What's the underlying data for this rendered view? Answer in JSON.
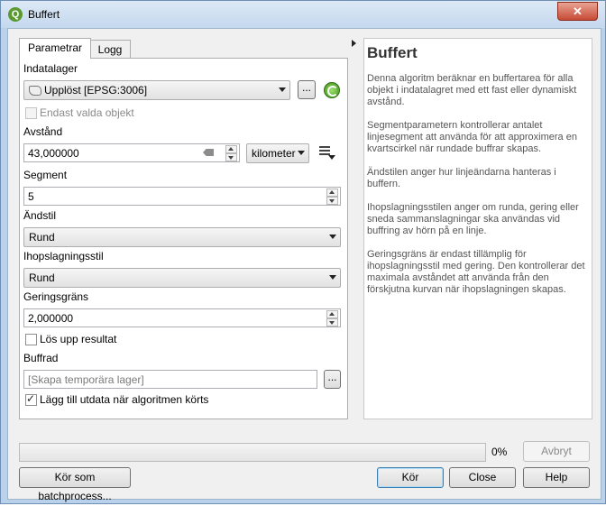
{
  "window": {
    "title": "Buffert",
    "app_icon": "qgis-icon",
    "close_glyph": "✕"
  },
  "tabs": [
    {
      "label": "Parametrar"
    },
    {
      "label": "Logg"
    }
  ],
  "params": {
    "input_label": "Indatalager",
    "input_value": "Upplöst [EPSG:3006]",
    "browse_label": "...",
    "selected_only_label": "Endast valda objekt",
    "distance_label": "Avstånd",
    "distance_value": "43,000000",
    "distance_unit": "kilometer",
    "segments_label": "Segment",
    "segments_value": "5",
    "endcap_label": "Ändstil",
    "endcap_value": "Rund",
    "join_label": "Ihopslagningsstil",
    "join_value": "Rund",
    "miter_label": "Geringsgräns",
    "miter_value": "2,000000",
    "dissolve_label": "Lös upp resultat",
    "output_label": "Buffrad",
    "output_placeholder": "[Skapa temporära lager]",
    "output_browse_label": "...",
    "open_output_label": "Lägg till utdata när algoritmen körts"
  },
  "help": {
    "title": "Buffert",
    "paragraphs": [
      "Denna algoritm beräknar en buffertarea för alla objekt i indatalagret med ett fast eller dynamiskt avstånd.",
      "Segmentparametern kontrollerar antalet linjesegment att använda för att approximera en kvartscirkel när rundade buffrar skapas.",
      "Ändstilen anger hur linjeändarna hanteras i buffern.",
      "Ihopslagningsstilen anger om runda, gering eller sneda sammanslagningar ska användas vid buffring av hörn på en linje.",
      "Geringsgräns är endast tillämplig för ihopslagningsstil med gering. Den kontrollerar det maximala avståndet att använda från den förskjutna kurvan när ihopslagningen skapas."
    ]
  },
  "progress": {
    "percent_label": "0%",
    "value": 0
  },
  "buttons": {
    "cancel": "Avbryt",
    "batch": "Kör som batchprocess...",
    "run": "Kör",
    "close": "Close",
    "help": "Help"
  },
  "states": {
    "selected_only": false,
    "dissolve": false,
    "open_output": true
  }
}
